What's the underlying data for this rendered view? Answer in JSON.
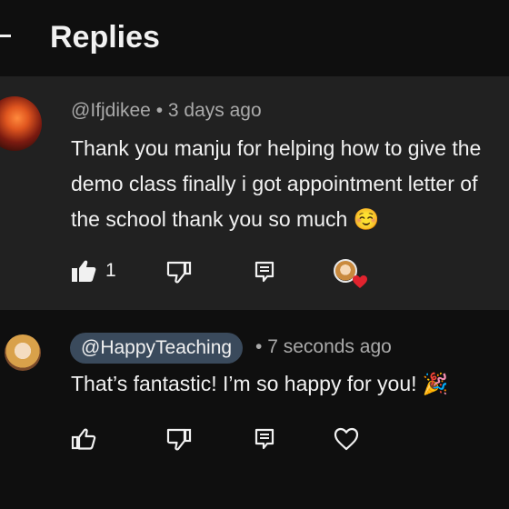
{
  "header": {
    "title": "Replies"
  },
  "parent_comment": {
    "author": "@Ifjdikee",
    "separator": "•",
    "time": "3 days ago",
    "text": "Thank you manju for helping how to give the demo class finally i got appointment letter of the school thank you so much ☺️",
    "like_count": "1",
    "icons": [
      "thumbs-up-filled-icon",
      "thumbs-down-icon",
      "reply-icon",
      "creator-heart-icon"
    ]
  },
  "reply": {
    "author": "@HappyTeaching",
    "separator": "•",
    "time": "7 seconds ago",
    "text": "That’s fantastic! I’m so happy for you! 🎉",
    "icons": [
      "thumbs-up-icon",
      "thumbs-down-icon",
      "reply-icon",
      "heart-icon"
    ]
  },
  "colors": {
    "background": "#0f0f0f",
    "comment_highlight": "#212121",
    "handle_chip": "#3a4a5c",
    "heart_badge": "#e1232e"
  }
}
